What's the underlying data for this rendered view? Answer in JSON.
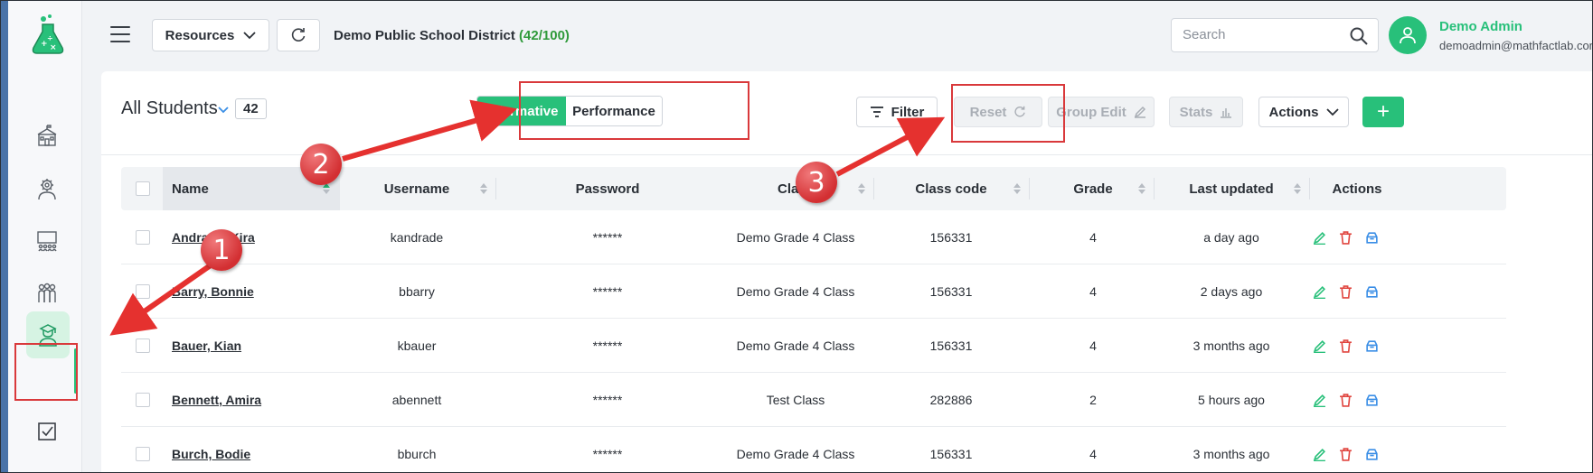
{
  "topbar": {
    "resources_label": "Resources",
    "district_name": "Demo Public School District",
    "district_count": "(42/100)",
    "search_placeholder": "Search",
    "user_name": "Demo Admin",
    "user_email": "demoadmin@mathfactlab.com"
  },
  "sidebar": {
    "items": [
      {
        "icon": "school-icon"
      },
      {
        "icon": "admin-gear-icon"
      },
      {
        "icon": "classroom-icon"
      },
      {
        "icon": "groups-icon"
      },
      {
        "icon": "student-icon",
        "active": true
      },
      {
        "icon": "checkbox-icon"
      }
    ]
  },
  "main": {
    "title": "All Students",
    "count": "42",
    "view_tabs": [
      "Informative",
      "Performance"
    ],
    "active_tab": "Informative",
    "toolbar": {
      "filter": "Filter",
      "reset": "Reset",
      "group_edit": "Group Edit",
      "stats": "Stats",
      "actions": "Actions",
      "add": "+"
    },
    "columns": [
      "Name",
      "Username",
      "Password",
      "Class",
      "Class code",
      "Grade",
      "Last updated",
      "Actions"
    ],
    "rows": [
      {
        "name": "Andrade, Kira",
        "username": "kandrade",
        "password": "******",
        "class": "Demo Grade 4 Class",
        "class_code": "156331",
        "grade": "4",
        "last_updated": "a day ago"
      },
      {
        "name": "Barry, Bonnie",
        "username": "bbarry",
        "password": "******",
        "class": "Demo Grade 4 Class",
        "class_code": "156331",
        "grade": "4",
        "last_updated": "2 days ago"
      },
      {
        "name": "Bauer, Kian",
        "username": "kbauer",
        "password": "******",
        "class": "Demo Grade 4 Class",
        "class_code": "156331",
        "grade": "4",
        "last_updated": "3 months ago"
      },
      {
        "name": "Bennett, Amira",
        "username": "abennett",
        "password": "******",
        "class": "Test Class",
        "class_code": "282886",
        "grade": "2",
        "last_updated": "5 hours ago"
      },
      {
        "name": "Burch, Bodie",
        "username": "bburch",
        "password": "******",
        "class": "Demo Grade 4 Class",
        "class_code": "156331",
        "grade": "4",
        "last_updated": "3 months ago"
      }
    ]
  },
  "annotations": {
    "step1": "1",
    "step2": "2",
    "step3": "3",
    "color": "#d9393b"
  },
  "colors": {
    "accent": "#28c07a",
    "count_green": "#2f9a3a",
    "delete_red": "#e0453f",
    "archive_blue": "#3a8ee6"
  }
}
